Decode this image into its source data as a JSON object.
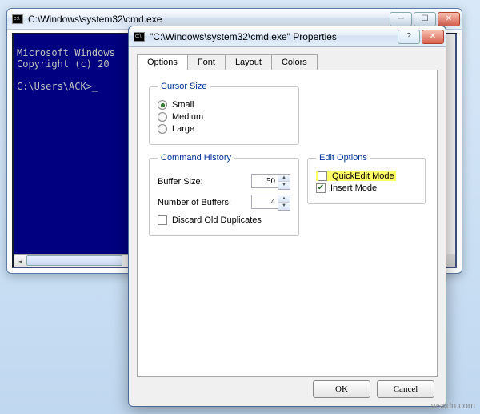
{
  "cmd": {
    "title": "C:\\Windows\\system32\\cmd.exe",
    "line1": "Microsoft Windows",
    "line2": "Copyright (c) 20",
    "prompt": "C:\\Users\\ACK>"
  },
  "dialog": {
    "title": "\"C:\\Windows\\system32\\cmd.exe\" Properties",
    "tabs": {
      "options": "Options",
      "font": "Font",
      "layout": "Layout",
      "colors": "Colors"
    },
    "cursor": {
      "legend": "Cursor Size",
      "small": "Small",
      "medium": "Medium",
      "large": "Large"
    },
    "history": {
      "legend": "Command History",
      "buffer_size_label": "Buffer Size:",
      "buffer_size_value": "50",
      "num_buffers_label": "Number of Buffers:",
      "num_buffers_value": "4",
      "discard_label": "Discard Old Duplicates"
    },
    "edit": {
      "legend": "Edit Options",
      "quickedit": "QuickEdit Mode",
      "insert": "Insert Mode"
    },
    "buttons": {
      "ok": "OK",
      "cancel": "Cancel"
    }
  },
  "watermark": "wsxdn.com"
}
